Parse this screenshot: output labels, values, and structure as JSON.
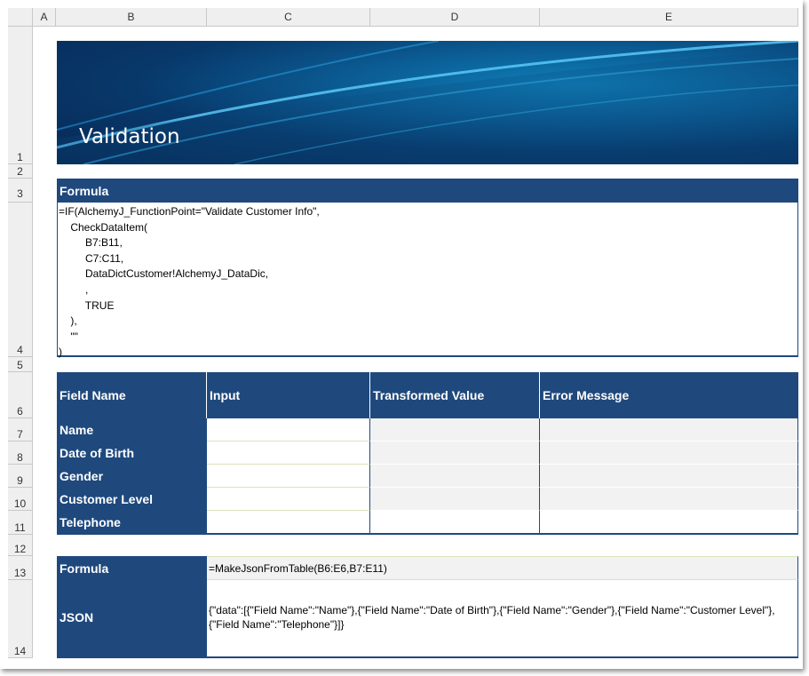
{
  "columns": [
    "A",
    "B",
    "C",
    "D",
    "E"
  ],
  "rows": [
    "1",
    "2",
    "3",
    "4",
    "5",
    "6",
    "7",
    "8",
    "9",
    "10",
    "11",
    "12",
    "13",
    "14"
  ],
  "banner": {
    "title": "Validation"
  },
  "formula_section": {
    "header": "Formula",
    "lines": [
      "=IF(AlchemyJ_FunctionPoint=\"Validate Customer Info\",",
      "    CheckDataItem(",
      "         B7:B11,",
      "         C7:C11,",
      "         DataDictCustomer!AlchemyJ_DataDic,",
      "         ,",
      "         TRUE",
      "    ),",
      "    \"\"",
      ")"
    ]
  },
  "table": {
    "headers": [
      "Field Name",
      "Input",
      "Transformed Value",
      "Error Message"
    ],
    "rows": [
      "Name",
      "Date of Birth",
      "Gender",
      "Customer Level",
      "Telephone"
    ]
  },
  "json_section": {
    "formula_label": "Formula",
    "formula_value": "=MakeJsonFromTable(B6:E6,B7:E11)",
    "json_label": "JSON",
    "json_value": "{\"data\":[{\"Field Name\":\"Name\"},{\"Field Name\":\"Date of Birth\"},{\"Field Name\":\"Gender\"},{\"Field Name\":\"Customer Level\"},{\"Field Name\":\"Telephone\"}]}"
  },
  "colors": {
    "header_fill": "#1f497d",
    "computed_fill": "#f2f2f2",
    "grid": "#c8c8c8"
  }
}
